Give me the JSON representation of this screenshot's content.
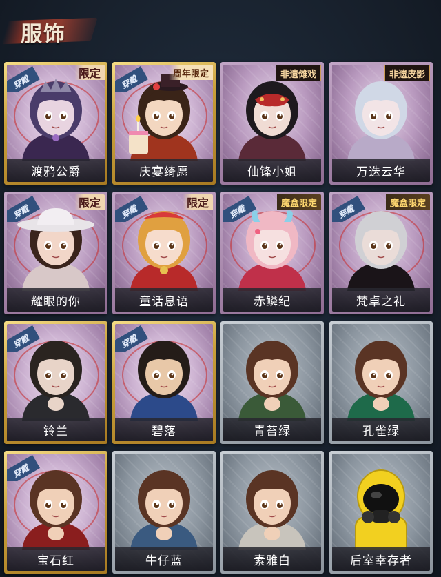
{
  "page": {
    "title": "服饰"
  },
  "wear_text": "穿戴",
  "cards": [
    {
      "name": "渡鸦公爵",
      "frame": "gold",
      "worn": true,
      "tag": "限定",
      "tagStyle": "xianding",
      "hair": "#4a3c6a",
      "skin": "#e8d4e0",
      "cloth": "#3a2750",
      "hat": "crown"
    },
    {
      "name": "庆宴绮愿",
      "frame": "gold",
      "worn": true,
      "tag": "周年限定",
      "tagStyle": "zhounian",
      "hair": "#3a2418",
      "skin": "#f3d7c0",
      "cloth": "#a0341e",
      "hat": "tophat"
    },
    {
      "name": "仙锋小姐",
      "frame": "purple",
      "worn": false,
      "tag": "非遗傩戏",
      "tagStyle": "feiyi",
      "hair": "#1e1a1e",
      "skin": "#f0dcd4",
      "cloth": "#5a2a38",
      "hat": "mask"
    },
    {
      "name": "万迭云华",
      "frame": "purple",
      "worn": false,
      "tag": "非遗皮影",
      "tagStyle": "feiyi",
      "hair": "#d0d8e6",
      "skin": "#f2e4e6",
      "cloth": "#b8aac8",
      "hat": "none"
    },
    {
      "name": "耀眼的你",
      "frame": "purple",
      "worn": true,
      "tag": "限定",
      "tagStyle": "xianding",
      "hair": "#3a241c",
      "skin": "#f2d6c8",
      "cloth": "#d8c8c8",
      "hat": "cowboy"
    },
    {
      "name": "童话息语",
      "frame": "purple",
      "worn": true,
      "tag": "限定",
      "tagStyle": "xianding",
      "hair": "#e0a040",
      "skin": "#f6dccc",
      "cloth": "#b82a2a",
      "hat": "bow"
    },
    {
      "name": "赤鳞纪",
      "frame": "purple",
      "worn": true,
      "tag": "魔盒限定",
      "tagStyle": "mohe",
      "hair": "#f0b8c4",
      "skin": "#f6e0e0",
      "cloth": "#c0304a",
      "hat": "horns"
    },
    {
      "name": "梵卓之礼",
      "frame": "purple",
      "worn": true,
      "tag": "魔盒限定",
      "tagStyle": "mohe",
      "hair": "#d0d0d4",
      "skin": "#eadcd8",
      "cloth": "#1a1418",
      "hat": "none"
    },
    {
      "name": "铃兰",
      "frame": "gold",
      "worn": true,
      "tag": "",
      "tagStyle": "",
      "hair": "#2a2420",
      "skin": "#e8d4c8",
      "cloth": "#2a2a2e",
      "hat": "none"
    },
    {
      "name": "碧落",
      "frame": "gold",
      "worn": true,
      "tag": "",
      "tagStyle": "",
      "hair": "#241c18",
      "skin": "#e8c8a8",
      "cloth": "#2c4a8a",
      "hat": "none"
    },
    {
      "name": "青苔绿",
      "frame": "gray",
      "worn": false,
      "tag": "",
      "tagStyle": "",
      "hair": "#5a3424",
      "skin": "#f0d0b8",
      "cloth": "#3a5a38",
      "hat": "none"
    },
    {
      "name": "孔雀绿",
      "frame": "gray",
      "worn": false,
      "tag": "",
      "tagStyle": "",
      "hair": "#5a3424",
      "skin": "#f0d0b8",
      "cloth": "#1e6a4a",
      "hat": "none"
    },
    {
      "name": "宝石红",
      "frame": "gold",
      "worn": true,
      "tag": "",
      "tagStyle": "",
      "hair": "#5a3424",
      "skin": "#f0d0b8",
      "cloth": "#8a1e1e",
      "hat": "none"
    },
    {
      "name": "牛仔蓝",
      "frame": "gray",
      "worn": false,
      "tag": "",
      "tagStyle": "",
      "hair": "#5a3424",
      "skin": "#f0d0b8",
      "cloth": "#3a5a80",
      "hat": "none"
    },
    {
      "name": "素雅白",
      "frame": "gray",
      "worn": false,
      "tag": "",
      "tagStyle": "",
      "hair": "#5a3424",
      "skin": "#f0d0b8",
      "cloth": "#c8c4bc",
      "hat": "none"
    },
    {
      "name": "后室幸存者",
      "frame": "gray",
      "worn": false,
      "tag": "",
      "tagStyle": "",
      "hair": "#f2d020",
      "skin": "#1a1a1a",
      "cloth": "#f2d020",
      "hat": "hazmat"
    }
  ]
}
